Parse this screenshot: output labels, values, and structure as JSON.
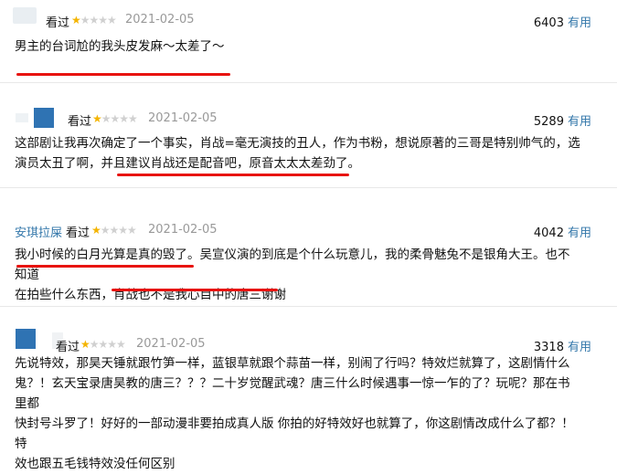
{
  "useful_label": "有用",
  "reviews": [
    {
      "username": "",
      "watched": "看过",
      "rating": 1,
      "date": "2021-02-05",
      "votes": "6403",
      "lines": [
        "男主的台词尬的我头皮发麻～太差了～"
      ]
    },
    {
      "username": "",
      "watched": "看过",
      "rating": 1,
      "date": "2021-02-05",
      "votes": "5289",
      "lines": [
        "这部剧让我再次确定了一个事实，肖战=毫无演技的丑人，作为书粉，想说原著的三哥是特别帅气的，选",
        "演员太丑了啊，并且建议肖战还是配音吧，原音太太太差劲了。"
      ]
    },
    {
      "username": "安琪拉屎",
      "watched": "看过",
      "rating": 1,
      "date": "2021-02-05",
      "votes": "4042",
      "lines": [
        "我小时候的白月光算是真的毁了。吴宣仪演的到底是个什么玩意儿，我的柔骨魅兔不是银角大王。也不知道",
        "在拍些什么东西，肖战也不是我心目中的唐三谢谢"
      ]
    },
    {
      "username": "",
      "watched": "看过",
      "rating": 1,
      "date": "2021-02-05",
      "votes": "3318",
      "lines": [
        "先说特效，那昊天锤就跟竹笋一样，蓝银草就跟个蒜苗一样，别闹了行吗？特效烂就算了，这剧情什么",
        "鬼？！玄天宝录唐昊教的唐三？？？二十岁觉醒武魂？唐三什么时候遇事一惊一乍的了？玩呢？那在书里都",
        "快封号斗罗了！好好的一部动漫非要拍成真人版 你拍的好特效好也就算了，你这剧情改成什么了都？！特",
        "效也跟五毛钱特效没任何区别"
      ]
    }
  ]
}
